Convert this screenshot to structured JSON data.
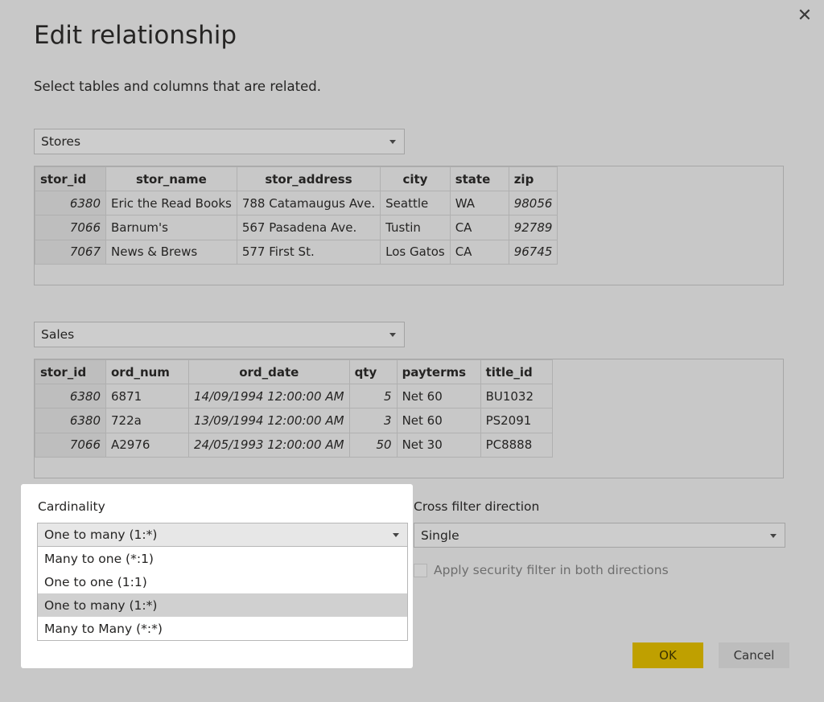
{
  "dialog": {
    "title": "Edit relationship",
    "subtitle": "Select tables and columns that are related.",
    "close_icon": "close-icon"
  },
  "table1": {
    "selected": "Stores",
    "columns": [
      "stor_id",
      "stor_name",
      "stor_address",
      "city",
      "state",
      "zip"
    ],
    "rows": [
      [
        "6380",
        "Eric the Read Books",
        "788 Catamaugus Ave.",
        "Seattle",
        "WA",
        "98056"
      ],
      [
        "7066",
        "Barnum's",
        "567 Pasadena Ave.",
        "Tustin",
        "CA",
        "92789"
      ],
      [
        "7067",
        "News & Brews",
        "577 First St.",
        "Los Gatos",
        "CA",
        "96745"
      ]
    ]
  },
  "table2": {
    "selected": "Sales",
    "columns": [
      "stor_id",
      "ord_num",
      "ord_date",
      "qty",
      "payterms",
      "title_id"
    ],
    "rows": [
      [
        "6380",
        "6871",
        "14/09/1994 12:00:00 AM",
        "5",
        "Net 60",
        "BU1032"
      ],
      [
        "6380",
        "722a",
        "13/09/1994 12:00:00 AM",
        "3",
        "Net 60",
        "PS2091"
      ],
      [
        "7066",
        "A2976",
        "24/05/1993 12:00:00 AM",
        "50",
        "Net 30",
        "PC8888"
      ]
    ]
  },
  "cardinality": {
    "label": "Cardinality",
    "selected": "One to many (1:*)",
    "options": [
      "Many to one (*:1)",
      "One to one (1:1)",
      "One to many (1:*)",
      "Many to Many (*:*)"
    ],
    "highlighted_index": 2
  },
  "cross_filter": {
    "label": "Cross filter direction",
    "selected": "Single",
    "security_label": "Apply security filter in both directions"
  },
  "buttons": {
    "ok": "OK",
    "cancel": "Cancel"
  },
  "colors": {
    "overlay": "#c8c8c8",
    "ok_button": "#bfa000",
    "popup": "#ffffff"
  }
}
